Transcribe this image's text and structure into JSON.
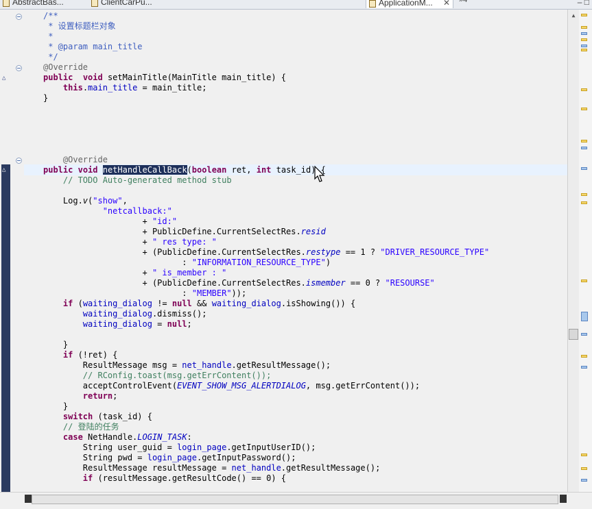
{
  "tabs": [
    {
      "label": "AbstractBas..."
    },
    {
      "label": "ClientCarPu..."
    },
    {
      "label": "ApplicationM...",
      "close": "✕"
    }
  ],
  "overflow": {
    "label": "»4"
  },
  "window_controls": {
    "min": "–",
    "max": "□"
  },
  "editor": {
    "lines": [
      [
        [
          "jd",
          "/**"
        ]
      ],
      [
        [
          "jd",
          " * 设置标题栏对象"
        ]
      ],
      [
        [
          "jd",
          " *"
        ]
      ],
      [
        [
          "jd",
          " * @param main_title"
        ]
      ],
      [
        [
          "jd",
          " */"
        ]
      ],
      [
        [
          "an",
          "@Override"
        ]
      ],
      [
        [
          "k",
          "public"
        ],
        [
          "",
          "  "
        ],
        [
          "k",
          "void"
        ],
        [
          "",
          " setMainTitle(MainTitle main_title) {"
        ]
      ],
      [
        [
          "",
          "    "
        ],
        [
          "k",
          "this"
        ],
        [
          "",
          "."
        ],
        [
          "f",
          "main_title"
        ],
        [
          "",
          " = main_title;"
        ]
      ],
      [
        [
          "",
          "}"
        ]
      ],
      [
        [
          "",
          ""
        ]
      ],
      [
        [
          "",
          ""
        ]
      ],
      [
        [
          "",
          ""
        ]
      ],
      [
        [
          "",
          ""
        ]
      ],
      [
        [
          "",
          ""
        ]
      ],
      [
        [
          "",
          "    "
        ],
        [
          "an",
          "@Override"
        ]
      ],
      [
        [
          "k",
          "public"
        ],
        [
          "",
          " "
        ],
        [
          "k",
          "void"
        ],
        [
          "",
          " "
        ],
        [
          "sel",
          "netHandleCallBack"
        ],
        [
          "",
          "("
        ],
        [
          "k",
          "boolean"
        ],
        [
          "",
          " ret, "
        ],
        [
          "k",
          "int"
        ],
        [
          "",
          " task_id) {"
        ]
      ],
      [
        [
          "",
          "    "
        ],
        [
          "c",
          "// TODO Auto-generated method stub"
        ]
      ],
      [
        [
          "",
          ""
        ]
      ],
      [
        [
          "",
          "    Log."
        ],
        [
          "it",
          "v"
        ],
        [
          "",
          "("
        ],
        [
          "s",
          "\"show\""
        ],
        [
          "",
          ","
        ]
      ],
      [
        [
          "",
          "            "
        ],
        [
          "s",
          "\"netcallback:\""
        ]
      ],
      [
        [
          "",
          "                    + "
        ],
        [
          "s",
          "\"id:\""
        ]
      ],
      [
        [
          "",
          "                    + PublicDefine.CurrentSelectRes."
        ],
        [
          "fi",
          "resid"
        ]
      ],
      [
        [
          "",
          "                    + "
        ],
        [
          "s",
          "\" res type: \""
        ]
      ],
      [
        [
          "",
          "                    + (PublicDefine.CurrentSelectRes."
        ],
        [
          "fi",
          "restype"
        ],
        [
          "",
          " == 1 ? "
        ],
        [
          "s",
          "\"DRIVER_RESOURCE_TYPE\""
        ]
      ],
      [
        [
          "",
          "                            : "
        ],
        [
          "s",
          "\"INFORMATION_RESOURCE_TYPE\""
        ],
        [
          "",
          ")"
        ]
      ],
      [
        [
          "",
          "                    + "
        ],
        [
          "s",
          "\" is_member : \""
        ]
      ],
      [
        [
          "",
          "                    + (PublicDefine.CurrentSelectRes."
        ],
        [
          "fi",
          "ismember"
        ],
        [
          "",
          " == 0 ? "
        ],
        [
          "s",
          "\"RESOURSE\""
        ]
      ],
      [
        [
          "",
          "                            : "
        ],
        [
          "s",
          "\"MEMBER\""
        ],
        [
          "",
          "));"
        ]
      ],
      [
        [
          "",
          "    "
        ],
        [
          "k",
          "if"
        ],
        [
          "",
          " ("
        ],
        [
          "f",
          "waiting_dialog"
        ],
        [
          "",
          " != "
        ],
        [
          "k",
          "null"
        ],
        [
          "",
          " && "
        ],
        [
          "f",
          "waiting_dialog"
        ],
        [
          "",
          ".isShowing()) {"
        ]
      ],
      [
        [
          "",
          "        "
        ],
        [
          "f",
          "waiting_dialog"
        ],
        [
          "",
          ".dismiss();"
        ]
      ],
      [
        [
          "",
          "        "
        ],
        [
          "f",
          "waiting_dialog"
        ],
        [
          "",
          " = "
        ],
        [
          "k",
          "null"
        ],
        [
          "",
          ";"
        ]
      ],
      [
        [
          "",
          ""
        ]
      ],
      [
        [
          "",
          "    }"
        ]
      ],
      [
        [
          "",
          "    "
        ],
        [
          "k",
          "if"
        ],
        [
          "",
          " (!ret) {"
        ]
      ],
      [
        [
          "",
          "        ResultMessage msg = "
        ],
        [
          "f",
          "net_handle"
        ],
        [
          "",
          ".getResultMessage();"
        ]
      ],
      [
        [
          "",
          "        "
        ],
        [
          "c",
          "// RConfig.toast(msg.getErrContent());"
        ]
      ],
      [
        [
          "",
          "        acceptControlEvent("
        ],
        [
          "fi",
          "EVENT_SHOW_MSG_ALERTDIALOG"
        ],
        [
          "",
          ", msg.getErrContent());"
        ]
      ],
      [
        [
          "",
          "        "
        ],
        [
          "k",
          "return"
        ],
        [
          "",
          ";"
        ]
      ],
      [
        [
          "",
          "    }"
        ]
      ],
      [
        [
          "",
          "    "
        ],
        [
          "k",
          "switch"
        ],
        [
          "",
          " (task_id) {"
        ]
      ],
      [
        [
          "",
          "    "
        ],
        [
          "c",
          "// 登陆的任务"
        ]
      ],
      [
        [
          "",
          "    "
        ],
        [
          "k",
          "case"
        ],
        [
          "",
          " NetHandle."
        ],
        [
          "fi",
          "LOGIN_TASK"
        ],
        [
          "",
          ":"
        ]
      ],
      [
        [
          "",
          "        String user_guid = "
        ],
        [
          "f",
          "login_page"
        ],
        [
          "",
          ".getInputUserID();"
        ]
      ],
      [
        [
          "",
          "        String pwd = "
        ],
        [
          "f",
          "login_page"
        ],
        [
          "",
          ".getInputPassword();"
        ]
      ],
      [
        [
          "",
          "        ResultMessage resultMessage = "
        ],
        [
          "f",
          "net_handle"
        ],
        [
          "",
          ".getResultMessage();"
        ]
      ],
      [
        [
          "",
          "        "
        ],
        [
          "k",
          "if"
        ],
        [
          "",
          " (resultMessage.getResultCode() == 0) {"
        ]
      ]
    ]
  },
  "colors": {
    "keyword": "#7f0055",
    "comment": "#3f7f5f",
    "javadoc": "#3f5fbf",
    "string": "#2a00ff",
    "field": "#0000c0",
    "annotation": "#646464",
    "selection": "#1d2f5a",
    "current_line": "#e8f2fe"
  },
  "icons": {
    "tab_icon": "java-file-icon",
    "fold": "collapse-fold-icon",
    "override": "override-indicator-icon",
    "cursor": "mouse-pointer-icon"
  }
}
